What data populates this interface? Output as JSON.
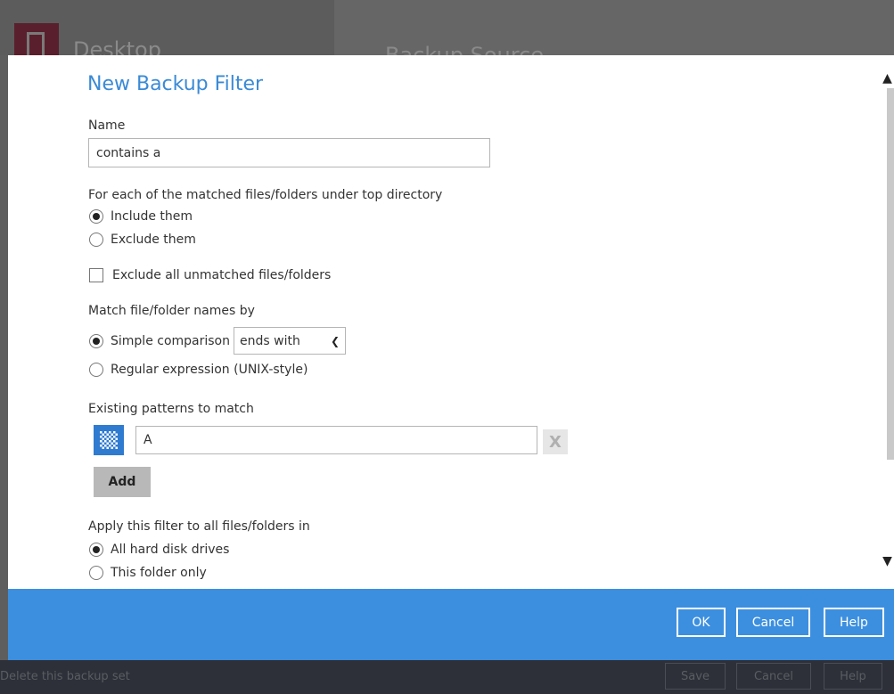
{
  "background": {
    "app_title": "Desktop",
    "section_title": "Backup Source",
    "footer_link": "Delete this backup set",
    "footer_buttons": {
      "save": "Save",
      "cancel": "Cancel",
      "help": "Help"
    }
  },
  "dialog": {
    "title": "New Backup Filter",
    "name_label": "Name",
    "name_value": "contains a",
    "matched_label": "For each of the matched files/folders under top directory",
    "include_label": "Include them",
    "exclude_label": "Exclude them",
    "exclude_unmatched_label": "Exclude all unmatched files/folders",
    "match_by_label": "Match file/folder names by",
    "simple_comparison_label": "Simple comparison",
    "comparison_select_value": "ends with",
    "regex_label": "Regular expression (UNIX-style)",
    "patterns_label": "Existing patterns to match",
    "pattern_value": "A",
    "remove_label": "X",
    "add_label": "Add",
    "apply_label": "Apply this filter to all files/folders in",
    "all_drives_label": "All hard disk drives",
    "this_folder_label": "This folder only",
    "footer_buttons": {
      "ok": "OK",
      "cancel": "Cancel",
      "help": "Help"
    }
  },
  "state": {
    "include_checked": true,
    "exclude_checked": false,
    "exclude_unmatched_checked": false,
    "simple_comparison_checked": true,
    "regex_checked": false,
    "all_drives_checked": true,
    "this_folder_checked": false
  },
  "colors": {
    "accent": "#3c8fdf",
    "title": "#3a8ad6",
    "overlay": "#5e5e5e",
    "footer_dark": "#2d3038"
  },
  "icons": {
    "pattern_icon": "checkerboard-pattern-icon",
    "remove_icon": "close-icon",
    "select_icon": "chevron-down-icon",
    "scroll_up": "chevron-up-icon",
    "scroll_down": "chevron-down-icon"
  }
}
